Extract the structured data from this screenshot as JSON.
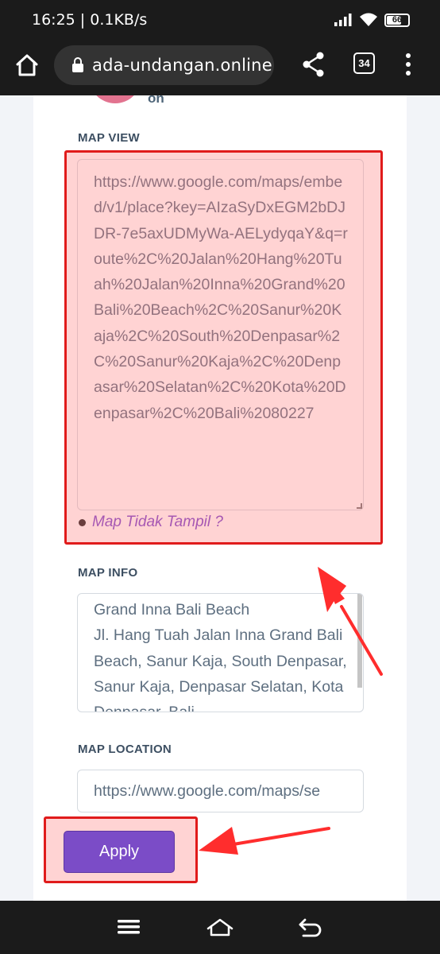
{
  "status": {
    "time_speed": "16:25 | 0.1KB/s",
    "battery": "66",
    "icons": [
      "signal-icon",
      "wifi-icon",
      "battery-icon"
    ]
  },
  "browser": {
    "url": "ada-undangan.online",
    "tab_count": "34",
    "icons": [
      "home-icon",
      "lock-icon",
      "share-icon",
      "tabs-icon",
      "more-vert-icon"
    ]
  },
  "page": {
    "partial_text": "on",
    "map_view": {
      "label": "MAP VIEW",
      "value": "https://www.google.com/maps/embed/v1/place?key=AIzaSyDxEGM2bDJDR-7e5axUDMyWa-AELydyqaY&q=route%2C%20Jalan%20Hang%20Tuah%20Jalan%20Inna%20Grand%20Bali%20Beach%2C%20Sanur%20Kaja%2C%20South%20Denpasar%2C%20Sanur%20Kaja%2C%20Denpasar%20Selatan%2C%20Kota%20Denpasar%2C%20Bali%2080227",
      "help_link": "Map Tidak Tampil ?"
    },
    "map_info": {
      "label": "MAP INFO",
      "value": "Grand Inna Bali Beach\nJl. Hang Tuah Jalan Inna Grand Bali Beach, Sanur Kaja, South Denpasar, Sanur Kaja, Denpasar Selatan, Kota Denpasar, Bali"
    },
    "map_location": {
      "label": "MAP LOCATION",
      "value": "https://www.google.com/maps/se"
    },
    "apply_label": "Apply"
  },
  "colors": {
    "highlight": "#e01b1b",
    "apply_button": "#7b4cc7",
    "link": "#7b48cf"
  },
  "navbar": {
    "icons": [
      "menu-icon",
      "home-outline-icon",
      "back-icon"
    ]
  }
}
